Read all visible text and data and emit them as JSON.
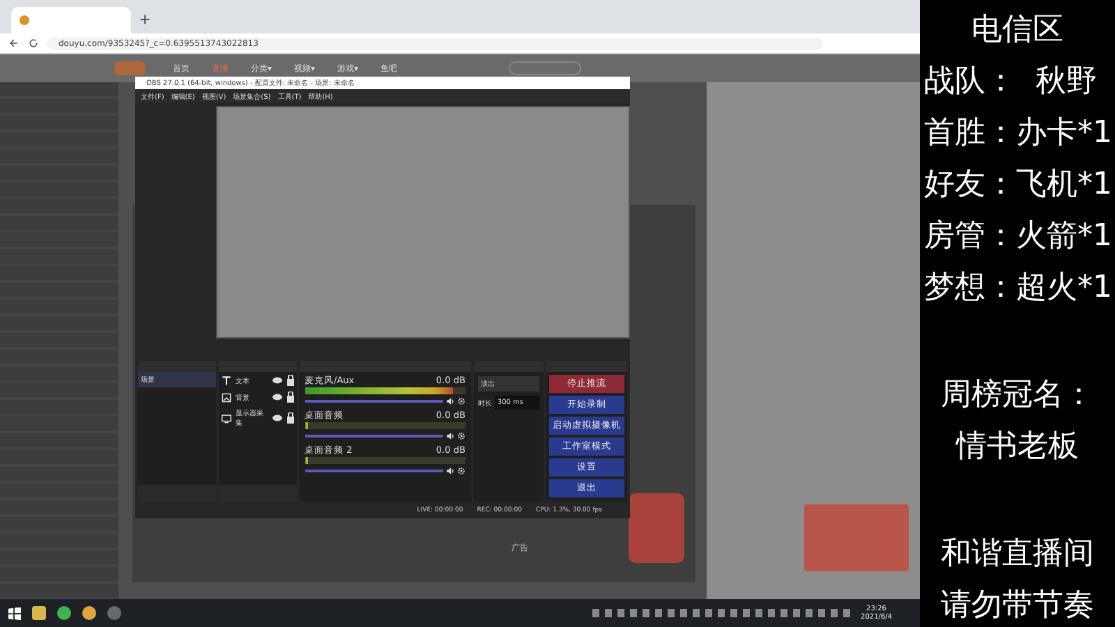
{
  "browser": {
    "url": "douyu.com/9353245?_c=0.6395513743022813",
    "nav": [
      {
        "label": "首页",
        "selected": false
      },
      {
        "label": "直播",
        "selected": true
      },
      {
        "label": "分类▾",
        "selected": false
      },
      {
        "label": "视频▾",
        "selected": false
      },
      {
        "label": "游戏▾",
        "selected": false
      },
      {
        "label": "鱼吧",
        "selected": false
      }
    ],
    "ad_label": "广告"
  },
  "obs": {
    "title": "OBS 27.0.1 (64-bit, windows) - 配置文件: 未命名 - 场景: 未命名",
    "menu": [
      "文件(F)",
      "编辑(E)",
      "视图(V)",
      "场景集合(S)",
      "工具(T)",
      "帮助(H)"
    ],
    "scenes": [
      {
        "label": "场景",
        "selected": true
      }
    ],
    "sources": [
      {
        "label": "文本",
        "kind": "text"
      },
      {
        "label": "背景",
        "kind": "image"
      },
      {
        "label": "显示器采集",
        "kind": "display"
      }
    ],
    "mixer": [
      {
        "name": "麦克风/Aux",
        "reading": "0.0 dB",
        "meter": {
          "level": 0.92
        },
        "volume": {
          "level": 1
        }
      },
      {
        "name": "桌面音频",
        "reading": "0.0 dB",
        "meter": {
          "level": 0
        },
        "volume": {
          "level": 1
        }
      },
      {
        "name": "桌面音频 2",
        "reading": "0.0 dB",
        "meter": {
          "level": 0
        },
        "volume": {
          "level": 1
        }
      }
    ],
    "transition": {
      "value": "淡出",
      "duration_label": "时长",
      "duration": "300 ms"
    },
    "controls": [
      {
        "label": "停止推流",
        "kind": "active"
      },
      {
        "label": "开始录制",
        "kind": "normal"
      },
      {
        "label": "启动虚拟摄像机",
        "kind": "normal"
      },
      {
        "label": "工作室模式",
        "kind": "normal"
      },
      {
        "label": "设置",
        "kind": "normal"
      },
      {
        "label": "退出",
        "kind": "normal"
      }
    ],
    "status": {
      "live": "LIVE: 00:00:00",
      "rec": "REC: 00:00:00",
      "cpu": "CPU: 1.3%, 30.00 fps"
    }
  },
  "taskbar": {
    "time": "23:26",
    "date": "2021/6/4"
  },
  "overlay": {
    "groups": [
      [
        "电信区",
        "战队：  秋野",
        "首胜：办卡*1",
        "好友：飞机*1",
        "房管：火箭*1",
        "梦想：超火*1"
      ],
      [
        "周榜冠名：",
        "情书老板"
      ],
      [
        "和谐直播间",
        "请勿带节奏"
      ]
    ]
  }
}
